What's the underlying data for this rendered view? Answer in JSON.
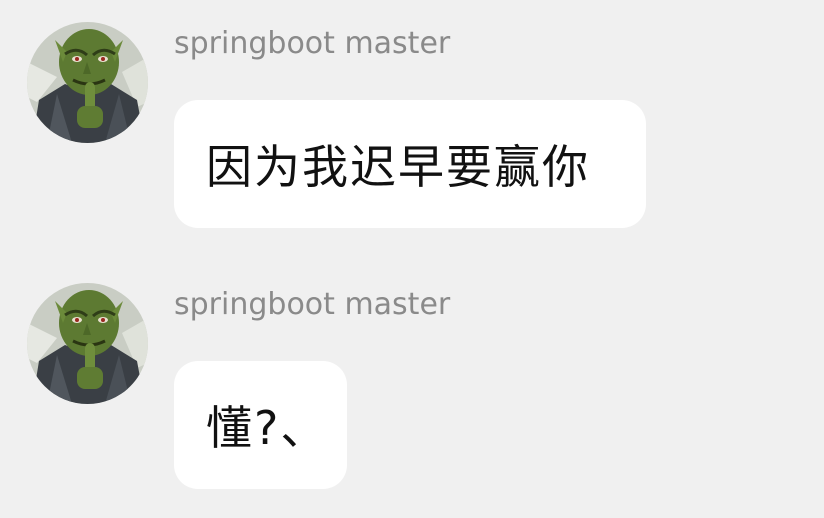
{
  "chat": {
    "messages": [
      {
        "sender": "springboot master",
        "avatar_icon": "goblin-avatar-icon",
        "text": "因为我迟早要赢你"
      },
      {
        "sender": "springboot master",
        "avatar_icon": "goblin-avatar-icon",
        "text": "懂?、"
      }
    ]
  },
  "colors": {
    "background": "#f0f0f0",
    "bubble": "#ffffff",
    "sender_name": "#8a8a8a",
    "message_text": "#111111"
  }
}
